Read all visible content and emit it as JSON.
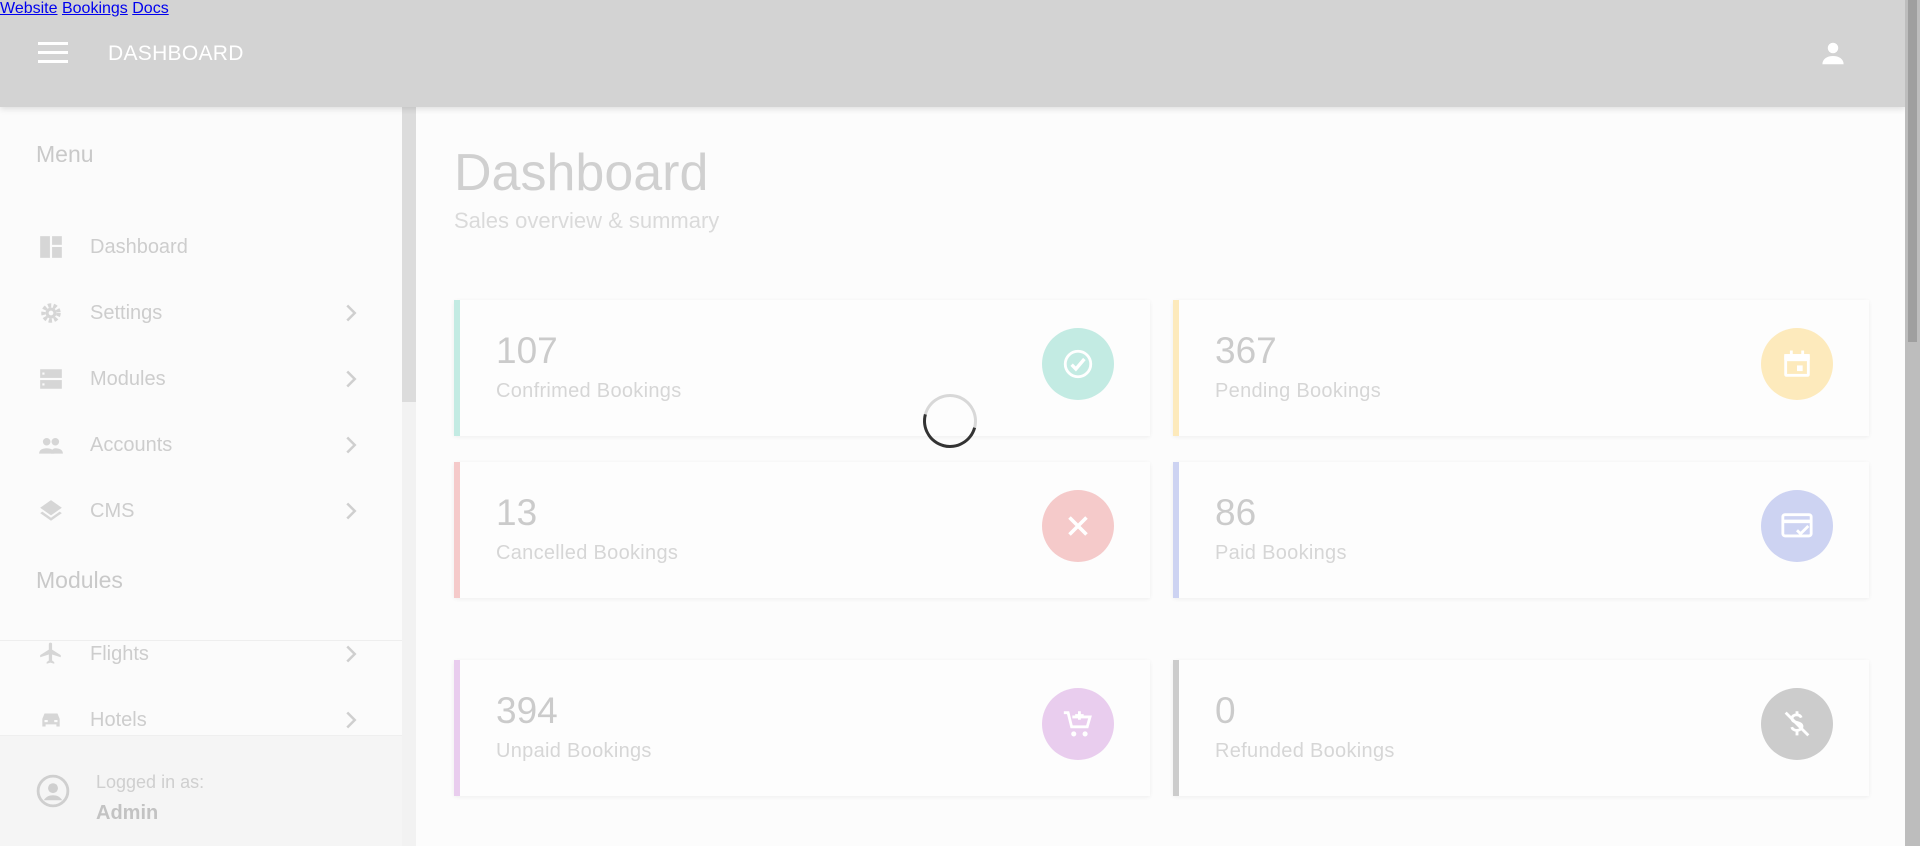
{
  "header": {
    "brand": "DASHBOARD",
    "nav": [
      "Website",
      "Bookings",
      "Docs"
    ]
  },
  "sidebar": {
    "menu_heading": "Menu",
    "items": [
      {
        "label": "Dashboard",
        "icon": "dashboard-icon"
      },
      {
        "label": "Settings",
        "icon": "gear-icon"
      },
      {
        "label": "Modules",
        "icon": "modules-icon"
      },
      {
        "label": "Accounts",
        "icon": "people-icon"
      },
      {
        "label": "CMS",
        "icon": "layers-icon"
      }
    ],
    "modules_heading": "Modules",
    "module_items": [
      {
        "label": "Flights",
        "icon": "airplane-icon"
      },
      {
        "label": "Hotels",
        "icon": "car-icon"
      }
    ],
    "footer": {
      "logged_in_label": "Logged in as:",
      "user": "Admin"
    }
  },
  "main": {
    "title": "Dashboard",
    "subtitle": "Sales overview & summary",
    "cards": [
      {
        "value": "107",
        "label": "Confrimed Bookings",
        "color": "#c3ebe3",
        "icon": "check-circle-icon"
      },
      {
        "value": "367",
        "label": "Pending Bookings",
        "color": "#fdeabc",
        "icon": "calendar-icon"
      },
      {
        "value": "13",
        "label": "Cancelled Bookings",
        "color": "#f5caca",
        "icon": "close-icon"
      },
      {
        "value": "86",
        "label": "Paid Bookings",
        "color": "#cdd3f2",
        "icon": "credit-card-check-icon"
      },
      {
        "value": "394",
        "label": "Unpaid Bookings",
        "color": "#e9cdee",
        "icon": "cart-icon"
      },
      {
        "value": "0",
        "label": "Refunded Bookings",
        "color": "#cccccc",
        "icon": "no-money-icon"
      }
    ]
  },
  "colors": {
    "topbar": "#d3d3d3",
    "loading_overlay": "#fcfcfc"
  }
}
